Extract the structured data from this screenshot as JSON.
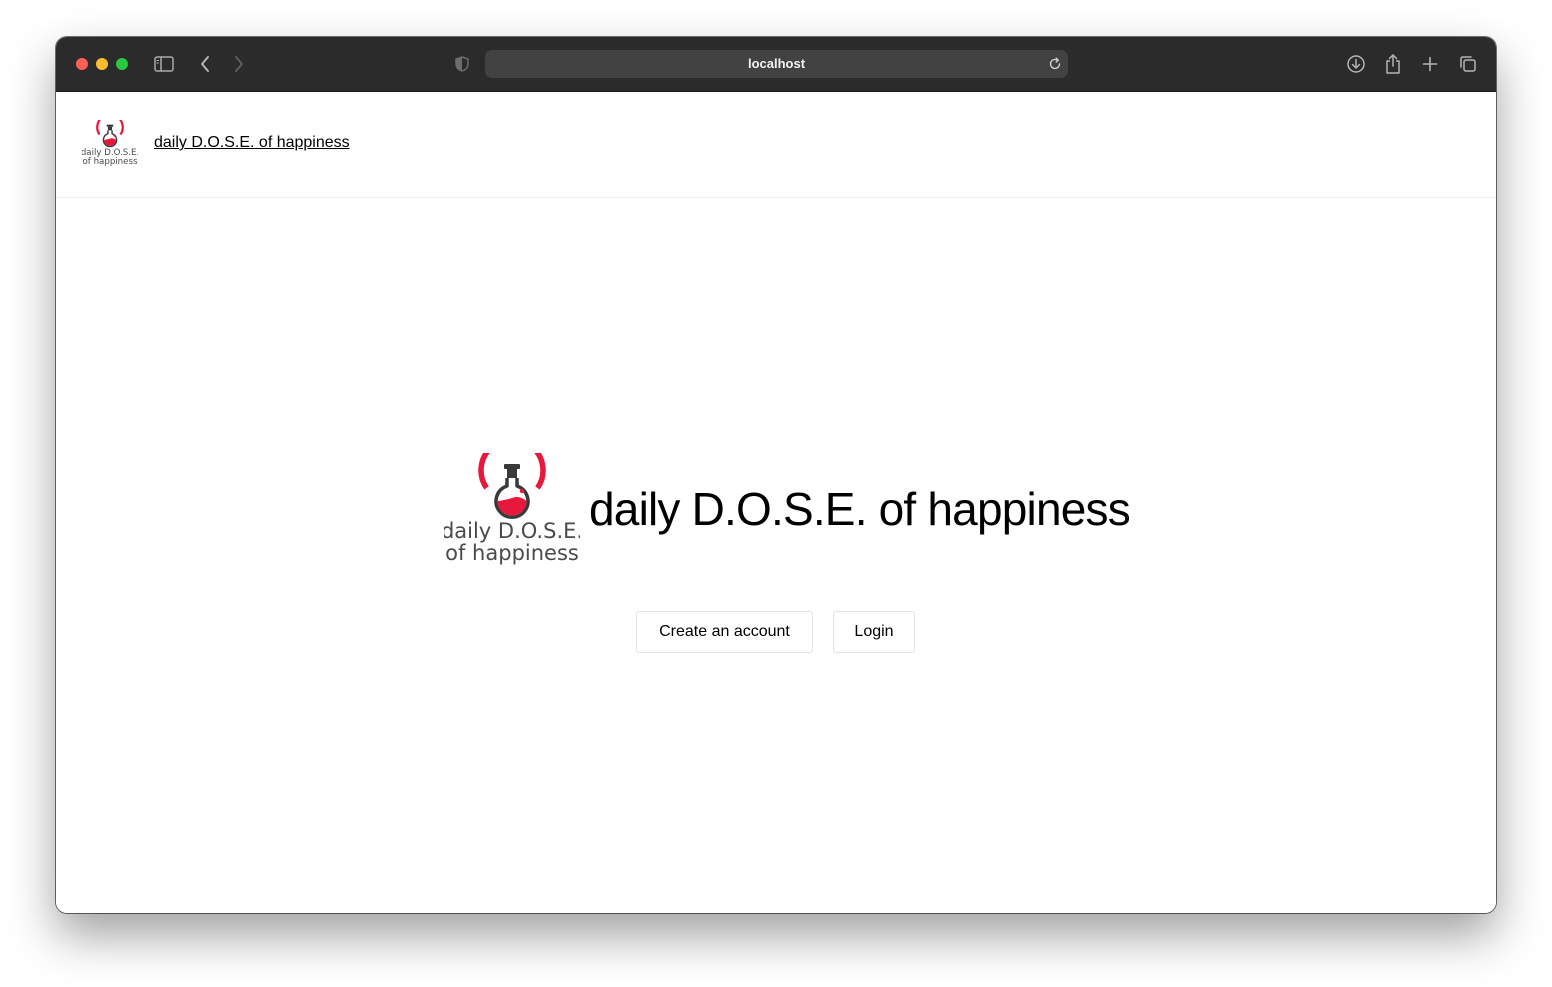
{
  "browser": {
    "url": "localhost"
  },
  "header": {
    "logo_line1": "daily D.O.S.E.",
    "logo_line2": "of happiness",
    "site_link": "daily D.O.S.E. of happiness"
  },
  "hero": {
    "logo_line1": "daily D.O.S.E.",
    "logo_line2": "of happiness",
    "title": "daily D.O.S.E. of happiness"
  },
  "actions": {
    "create_label": "Create an account",
    "login_label": "Login"
  },
  "colors": {
    "brand_red": "#e8173c",
    "logo_text": "#4a4a4a",
    "titlebar": "#2c2b2c"
  },
  "icons": {
    "sidebar": "sidebar-toggle-icon",
    "back": "chevron-left-icon",
    "forward": "chevron-right-icon",
    "privacy": "shield-icon",
    "reload": "reload-icon",
    "download": "download-icon",
    "share": "share-icon",
    "new_tab": "plus-icon",
    "tabs": "tabs-overview-icon"
  }
}
